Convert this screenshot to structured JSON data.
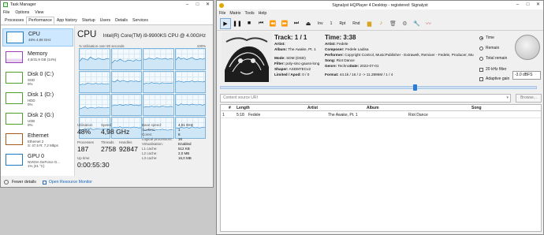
{
  "task_manager": {
    "title": "Task Manager",
    "menu": [
      "File",
      "Options",
      "View"
    ],
    "tabs": [
      "Processes",
      "Performance",
      "App history",
      "Startup",
      "Users",
      "Details",
      "Services"
    ],
    "active_tab": "Performance",
    "resources": [
      {
        "name": "CPU",
        "detail": "48% 4,98 GHz",
        "detail2": "",
        "color": "#1b79c2"
      },
      {
        "name": "Memory",
        "detail": "4,6/31,9 GB (14%)",
        "detail2": "",
        "color": "#9a3fb8"
      },
      {
        "name": "Disk 0 (C:)",
        "detail": "SSD",
        "detail2": "0%",
        "color": "#4da12b"
      },
      {
        "name": "Disk 1 (D:)",
        "detail": "HDD",
        "detail2": "0%",
        "color": "#4da12b"
      },
      {
        "name": "Disk 2 (G:)",
        "detail": "USB",
        "detail2": "0%",
        "color": "#4da12b"
      },
      {
        "name": "Ethernet",
        "detail": "Ethernet 2",
        "detail2": "S: 47,5 R: 7,2 Mbps",
        "color": "#a65a1c"
      },
      {
        "name": "GPU 0",
        "detail": "NVIDIA GeForce G...",
        "detail2": "1% (41 °C)",
        "color": "#1b79c2"
      }
    ],
    "cpu": {
      "title": "CPU",
      "model": "Intel(R) Core(TM) i9-9900KS CPU @ 4.00GHz",
      "util_label": "% Utilisation over 60 seconds",
      "util_max": "100%",
      "core_graphs": [
        [
          40,
          55,
          50,
          45,
          60,
          52,
          48,
          55,
          50,
          47,
          53,
          50
        ],
        [
          30,
          45,
          40,
          50,
          42,
          38,
          46,
          44,
          40,
          48,
          42,
          45
        ],
        [
          50,
          48,
          55,
          52,
          49,
          57,
          51,
          50,
          54,
          49,
          52,
          50
        ],
        [
          45,
          60,
          50,
          55,
          48,
          52,
          58,
          50,
          47,
          53,
          49,
          55
        ],
        [
          35,
          40,
          38,
          45,
          42,
          40,
          44,
          39,
          43,
          41,
          40,
          42
        ],
        [
          55,
          50,
          60,
          52,
          58,
          54,
          50,
          57,
          53,
          55,
          51,
          56
        ],
        [
          40,
          45,
          42,
          48,
          44,
          46,
          41,
          47,
          43,
          45,
          44,
          46
        ],
        [
          50,
          55,
          52,
          49,
          53,
          51,
          56,
          50,
          54,
          52,
          50,
          53
        ],
        [
          30,
          35,
          40,
          33,
          38,
          36,
          34,
          39,
          37,
          35,
          36,
          38
        ],
        [
          45,
          50,
          48,
          52,
          47,
          51,
          49,
          53,
          48,
          50,
          46,
          52
        ],
        [
          38,
          42,
          40,
          44,
          41,
          43,
          39,
          45,
          42,
          40,
          43,
          41
        ],
        [
          52,
          48,
          55,
          50,
          53,
          49,
          54,
          51,
          50,
          52,
          48,
          53
        ],
        [
          42,
          40,
          45,
          43,
          47,
          41,
          44,
          46,
          42,
          45,
          43,
          44
        ],
        [
          48,
          52,
          50,
          55,
          49,
          53,
          51,
          50,
          54,
          52,
          49,
          51
        ],
        [
          36,
          38,
          42,
          40,
          37,
          41,
          39,
          43,
          40,
          38,
          41,
          39
        ],
        [
          50,
          47,
          53,
          49,
          52,
          48,
          55,
          50,
          51,
          49,
          53,
          50
        ]
      ],
      "utilisation_label": "Utilisation",
      "utilisation": "48%",
      "speed_label": "Speed",
      "speed": "4,98 GHz",
      "processes_label": "Processes",
      "processes": "187",
      "threads_label": "Threads",
      "threads": "2758",
      "handles_label": "Handles",
      "handles": "92847",
      "uptime_label": "Up time",
      "uptime": "0:00:55:30",
      "specs": [
        {
          "label": "Base speed:",
          "value": "4,01 GHz"
        },
        {
          "label": "Sockets:",
          "value": "1"
        },
        {
          "label": "Cores:",
          "value": "8"
        },
        {
          "label": "Logical processors:",
          "value": "16"
        },
        {
          "label": "Virtualisation:",
          "value": "Enabled"
        },
        {
          "label": "L1 cache:",
          "value": "512 KB"
        },
        {
          "label": "L2 cache:",
          "value": "2,0 MB"
        },
        {
          "label": "L3 cache:",
          "value": "16,0 MB"
        }
      ]
    },
    "footer": {
      "fewer_details": "Fewer details",
      "resource_monitor": "Open Resource Monitor"
    }
  },
  "hqplayer": {
    "title": "Signalyst HQPlayer 4 Desktop - registered: Signalyst",
    "menu": [
      "File",
      "Matrix",
      "Tools",
      "Help"
    ],
    "toolbar": {
      "inv": "Inv",
      "track_no": "1",
      "rpt": "Rpt",
      "rnd": "Rnd"
    },
    "track_line": "Track: 1 / 1",
    "artist_label": "Artist:",
    "artist": "",
    "album_label": "Album:",
    "album": "The Awake, Pt. 1",
    "mode_label": "Mode:",
    "mode": "SDM (DSD)",
    "filter_label": "Filter:",
    "filter": "poly-sinc-gauss-long",
    "shaper_label": "Shaper:",
    "shaper": "ASDM7ECv2",
    "limited_label": "Limited / Apod:",
    "limited": "0 / 0",
    "time_line": "Time: 3:38",
    "t_artist_label": "Artist:",
    "t_artist": "Fedele",
    "composer_label": "Composer:",
    "composer": "Fedele Ladisa",
    "performer_label": "Performer:",
    "performer": "Copyright Control, MusicPublisher - Extrawelt, Remixer - Fedele, Producer, Mu",
    "song_label": "Song:",
    "song": "Riot Dance",
    "genre_label": "Genre:",
    "genre": "Techno",
    "date_label": "Date:",
    "date": "2022-07-01",
    "format_label": "Format:",
    "format": "44.1k / 16 / 2 -> 11.2896M / 1 / 4",
    "time_mode": [
      "Time",
      "Remain",
      "Total remain"
    ],
    "time_mode_selected": "Time",
    "filter_20k": "20 kHz filter",
    "adaptive_gain": "Adaptive gain",
    "volume": "-3.0 dBFS",
    "seek_fraction": 0.61,
    "uri_placeholder": "Content source URI",
    "browse": "Browse...",
    "playlist": {
      "columns": [
        "#",
        "Length",
        "Artist",
        "Album",
        "Song"
      ],
      "rows": [
        {
          "num": "1",
          "length": "5:18",
          "artist": "Fedele",
          "album": "The Awake, Pt. 1",
          "song": "Riot Dance"
        }
      ]
    }
  }
}
